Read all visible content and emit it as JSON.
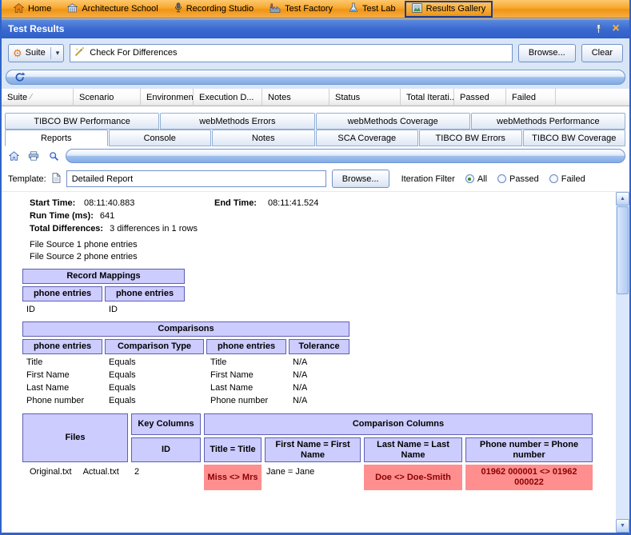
{
  "colors": {
    "menubar_orange": "#f6a223",
    "titlebar_blue": "#3a6ad0",
    "header_lavender": "#ccccff",
    "diff_red": "#ff8f8f"
  },
  "icons": {
    "gear": "⚙",
    "dropdown": "▾",
    "close": "×",
    "sort": "∕",
    "scroll_up": "▲",
    "scroll_down": "▼"
  },
  "menu": {
    "items": [
      {
        "label": "Home"
      },
      {
        "label": "Architecture School"
      },
      {
        "label": "Recording Studio"
      },
      {
        "label": "Test Factory"
      },
      {
        "label": "Test Lab"
      },
      {
        "label": "Results Gallery"
      }
    ]
  },
  "window": {
    "title": "Test Results"
  },
  "toolbar": {
    "suite_label": "Suite",
    "search_value": "Check For Differences",
    "browse_label": "Browse...",
    "clear_label": "Clear"
  },
  "grid": {
    "columns": [
      "Suite",
      "Scenario",
      "Environment",
      "Execution D...",
      "Notes",
      "Status",
      "Total Iterati...",
      "Passed",
      "Failed"
    ]
  },
  "tabs_upper": [
    "TIBCO BW Performance",
    "webMethods Errors",
    "webMethods Coverage",
    "webMethods Performance"
  ],
  "tabs_lower": [
    "Reports",
    "Console",
    "Notes",
    "SCA Coverage",
    "TIBCO BW Errors",
    "TIBCO BW Coverage"
  ],
  "template_bar": {
    "label": "Template:",
    "value": "Detailed Report",
    "browse_label": "Browse...",
    "filter_label": "Iteration Filter",
    "radio_all": "All",
    "radio_passed": "Passed",
    "radio_failed": "Failed"
  },
  "report": {
    "start_time_label": "Start Time:",
    "start_time": "08:11:40.883",
    "end_time_label": "End Time:",
    "end_time": "08:11:41.524",
    "run_time_label": "Run Time (ms):",
    "run_time": "641",
    "total_diff_label": "Total Differences:",
    "total_diff": "3 differences in 1 rows",
    "file_source_1_label": "File Source 1",
    "file_source_1": "phone entries",
    "file_source_2_label": "File Source 2",
    "file_source_2": "phone entries",
    "record_mappings": {
      "title": "Record Mappings",
      "col1": "phone entries",
      "col2": "phone entries",
      "row_col1": "ID",
      "row_col2": "ID"
    },
    "comparisons": {
      "title": "Comparisons",
      "headers": [
        "phone entries",
        "Comparison Type",
        "phone entries",
        "Tolerance"
      ],
      "rows": [
        [
          "Title",
          "Equals",
          "Title",
          "N/A"
        ],
        [
          "First Name",
          "Equals",
          "First Name",
          "N/A"
        ],
        [
          "Last Name",
          "Equals",
          "Last Name",
          "N/A"
        ],
        [
          "Phone number",
          "Equals",
          "Phone number",
          "N/A"
        ]
      ]
    },
    "results": {
      "files_header": "Files",
      "key_header": "Key Columns",
      "comparison_header": "Comparison Columns",
      "key_sub": "ID",
      "sub_headers": [
        "Title = Title",
        "First Name = First Name",
        "Last Name = Last Name",
        "Phone number = Phone number"
      ],
      "file1": "Original.txt",
      "file2": "Actual.txt",
      "key_value": "2",
      "cells": [
        {
          "text": "Miss <> Mrs",
          "diff": true
        },
        {
          "text": "Jane = Jane",
          "diff": false
        },
        {
          "text": "Doe <> Doe-Smith",
          "diff": true
        },
        {
          "text": "01962 000001 <> 01962 000022",
          "diff": true
        }
      ]
    }
  }
}
